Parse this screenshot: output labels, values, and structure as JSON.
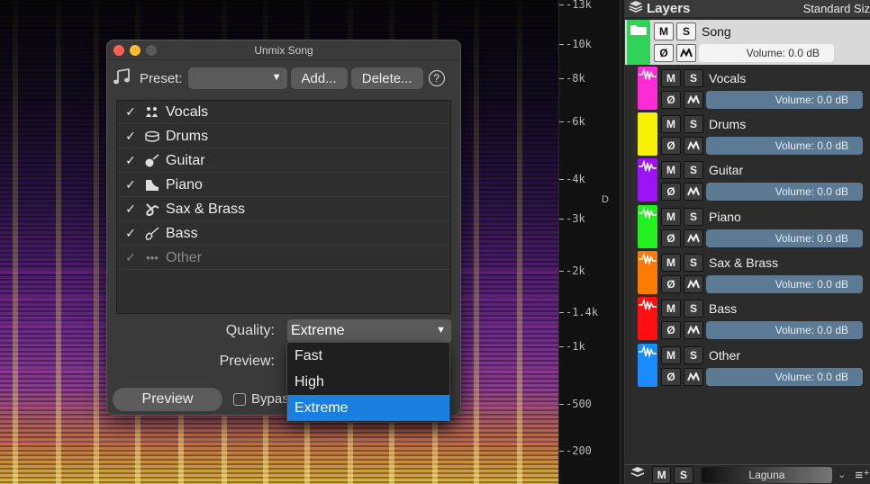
{
  "colors": {
    "accent": "#1b7fe0",
    "traffic_red": "#ff5f57",
    "traffic_yellow": "#febc2e",
    "traffic_gray": "#5a5a5a",
    "song": "#2fd35a",
    "vocals": "#ff2bd6",
    "drums": "#f7f000",
    "guitar": "#9a12f5",
    "piano": "#23f020",
    "sax": "#ff7a00",
    "bass": "#ff0f0f",
    "other": "#1a8cff"
  },
  "axis": {
    "ticks": [
      "-13k",
      "-10k",
      "-8k",
      "-6k",
      "-4k",
      "-3k",
      "-2k",
      "-1.4k",
      "-1k",
      "-500",
      "-200"
    ],
    "marker": "D"
  },
  "layers": {
    "title": "Layers",
    "size_label": "Standard Siz",
    "mute": "M",
    "solo": "S",
    "phase": "Ø",
    "items": [
      {
        "name": "Song",
        "volume": "Volume: 0.0 dB"
      },
      {
        "name": "Vocals",
        "volume": "Volume: 0.0 dB"
      },
      {
        "name": "Drums",
        "volume": "Volume: 0.0 dB"
      },
      {
        "name": "Guitar",
        "volume": "Volume: 0.0 dB"
      },
      {
        "name": "Piano",
        "volume": "Volume: 0.0 dB"
      },
      {
        "name": "Sax & Brass",
        "volume": "Volume: 0.0 dB"
      },
      {
        "name": "Bass",
        "volume": "Volume: 0.0 dB"
      },
      {
        "name": "Other",
        "volume": "Volume: 0.0 dB"
      }
    ],
    "footer": {
      "mute": "M",
      "solo": "S",
      "palette": "Laguna"
    }
  },
  "dialog": {
    "title": "Unmix Song",
    "preset_label": "Preset:",
    "add_label": "Add...",
    "delete_label": "Delete...",
    "help": "?",
    "stems": [
      {
        "label": "Vocals",
        "checked": "✓"
      },
      {
        "label": "Drums",
        "checked": "✓"
      },
      {
        "label": "Guitar",
        "checked": "✓"
      },
      {
        "label": "Piano",
        "checked": "✓"
      },
      {
        "label": "Sax & Brass",
        "checked": "✓"
      },
      {
        "label": "Bass",
        "checked": "✓"
      },
      {
        "label": "Other",
        "checked": "✓"
      }
    ],
    "quality_label": "Quality:",
    "quality_value": "Extreme",
    "preview_label": "Preview:",
    "preview_button": "Preview",
    "bypass_label": "Bypass",
    "quality_options": [
      "Fast",
      "High",
      "Extreme"
    ]
  }
}
